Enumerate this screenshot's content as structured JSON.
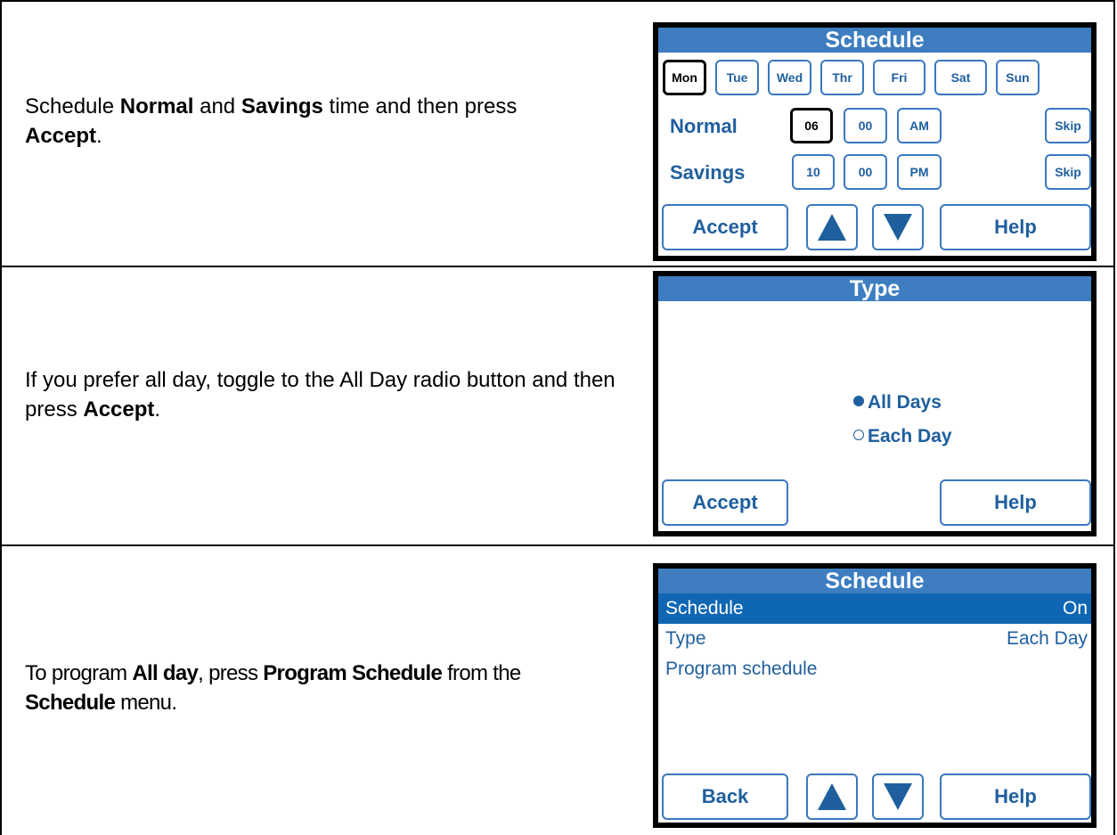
{
  "rows": [
    {
      "desc": {
        "p1": "Schedule ",
        "b1": "Normal",
        "p2": " and ",
        "b2": "Savings",
        "p3": " time and then press ",
        "b3": "Accept",
        "p4": "."
      },
      "screen": {
        "title": "Schedule",
        "days": [
          "Mon",
          "Tue",
          "Wed",
          "Thr",
          "Fri",
          "Sat",
          "Sun"
        ],
        "selected_day": "Mon",
        "normal": {
          "label": "Normal",
          "hour": "06",
          "minute": "00",
          "ampm": "AM",
          "skip": "Skip"
        },
        "savings": {
          "label": "Savings",
          "hour": "10",
          "minute": "00",
          "ampm": "PM",
          "skip": "Skip"
        },
        "accept": "Accept",
        "help": "Help",
        "up_icon": "up-arrow-icon",
        "down_icon": "down-arrow-icon"
      }
    },
    {
      "desc": {
        "p1": "If you prefer all day, toggle to the All Day radio button and then press ",
        "b1": "Accept",
        "p2": "."
      },
      "screen": {
        "title": "Type",
        "options": [
          "All Days",
          "Each Day"
        ],
        "selected": "All Days",
        "accept": "Accept",
        "help": "Help"
      }
    },
    {
      "desc": {
        "p1": "To program ",
        "b1": "All day",
        "p2": ", press ",
        "b2": "Program Schedule",
        "p3": " from the ",
        "b3": "Schedule",
        "p4": " menu."
      },
      "screen": {
        "title": "Schedule",
        "items": [
          {
            "label": "Schedule",
            "value": "On"
          },
          {
            "label": "Type",
            "value": "Each Day"
          },
          {
            "label": "Program schedule",
            "value": ""
          }
        ],
        "back": "Back",
        "help": "Help"
      }
    }
  ],
  "colors": {
    "title_bar": "#3d7dc0",
    "button_border": "#3a78bf",
    "button_text": "#1f5f9e",
    "highlight_row": "#0f67b4"
  }
}
